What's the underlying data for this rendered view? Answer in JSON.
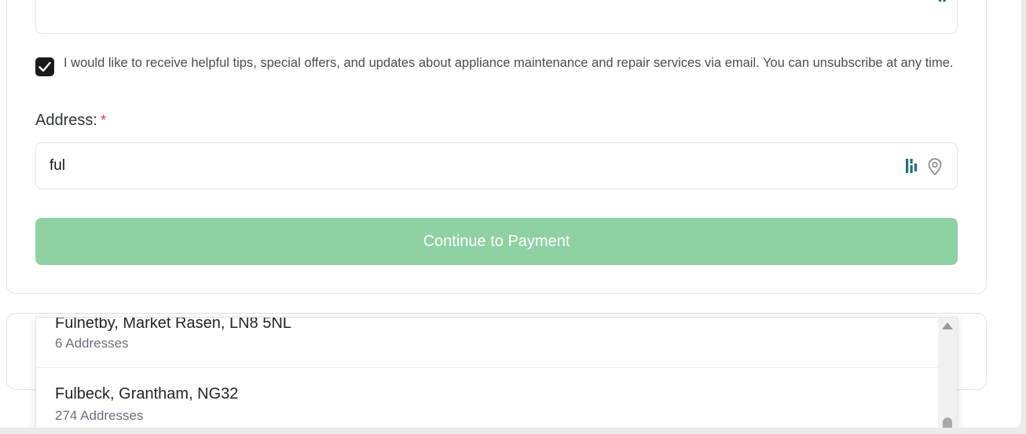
{
  "consent": {
    "checked": true,
    "text": "I would like to receive helpful tips, special offers, and updates about appliance maintenance and repair services via email. You can unsubscribe at any time."
  },
  "address": {
    "label": "Address:",
    "required_mark": "*",
    "value": "ful"
  },
  "payment_button": {
    "label": "Continue to Payment"
  },
  "suggestions": [
    {
      "title": "Fulnetby, Market Rasen, LN8 5NL",
      "subtitle": "6 Addresses"
    },
    {
      "title": "Fulbeck, Grantham, NG32",
      "subtitle": "274 Addresses"
    }
  ],
  "icons": {
    "brand": "brand-logo-icon",
    "location": "location-pin-icon",
    "check": "check-icon"
  },
  "colors": {
    "brand_teal": "#1f6f72",
    "button_green": "#8ed1a3",
    "required_red": "#d93a3a"
  }
}
